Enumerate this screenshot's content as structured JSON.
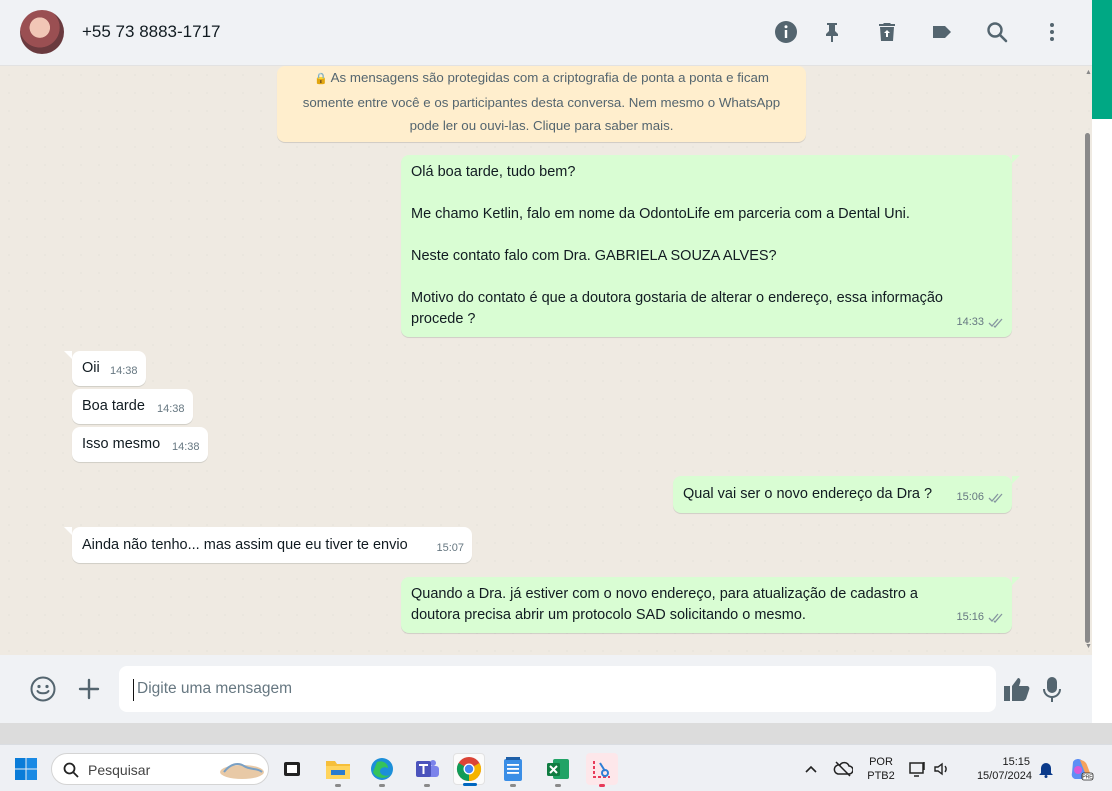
{
  "header": {
    "contact_name": "+55 73 8883-1717",
    "icons": [
      "info-icon",
      "pin-icon",
      "delete-icon",
      "label-icon",
      "search-icon",
      "menu-icon"
    ]
  },
  "encryption_notice": {
    "line1": "As mensagens são protegidas com a criptografia de ponta a ponta e ficam",
    "line2": "somente entre você e os participantes desta conversa. Nem mesmo o WhatsApp",
    "line3": "pode ler ou ouvi-las. Clique para saber mais."
  },
  "messages": [
    {
      "direction": "out",
      "paragraphs": [
        "Olá boa tarde, tudo bem?",
        "Me chamo Ketlin, falo em nome da OdontoLife em parceria com a Dental Uni.",
        "Neste contato falo com Dra. GABRIELA SOUZA ALVES?",
        "Motivo do contato é que a doutora gostaria de alterar o endereço, essa informação",
        "procede ?"
      ],
      "time": "14:33",
      "status": "read"
    },
    {
      "direction": "in",
      "text": "Oii",
      "time": "14:38"
    },
    {
      "direction": "in",
      "text": "Boa tarde",
      "time": "14:38"
    },
    {
      "direction": "in",
      "text": "Isso mesmo",
      "time": "14:38"
    },
    {
      "direction": "out",
      "text": "Qual vai ser o novo endereço da Dra ?",
      "time": "15:06",
      "status": "read"
    },
    {
      "direction": "in",
      "text": "Ainda não tenho... mas assim que eu tiver te envio",
      "time": "15:07"
    },
    {
      "direction": "out",
      "paragraphs": [
        "Quando a Dra. já estiver com o novo endereço, para atualização de cadastro a",
        "doutora precisa abrir um protocolo SAD solicitando o mesmo."
      ],
      "time": "15:16",
      "status": "read"
    }
  ],
  "composer": {
    "placeholder": "Digite uma mensagem"
  },
  "taskbar": {
    "search_placeholder": "Pesquisar",
    "language": "POR",
    "layout": "PTB2",
    "time": "15:15",
    "date": "15/07/2024",
    "apps": [
      "file-explorer",
      "edge",
      "teams",
      "chrome",
      "notepad",
      "excel",
      "snipping-tool"
    ]
  },
  "colors": {
    "accent": "#00a884",
    "outgoing_bubble": "#d9fdd3",
    "incoming_bubble": "#ffffff",
    "notice_bg": "#ffeecd"
  }
}
